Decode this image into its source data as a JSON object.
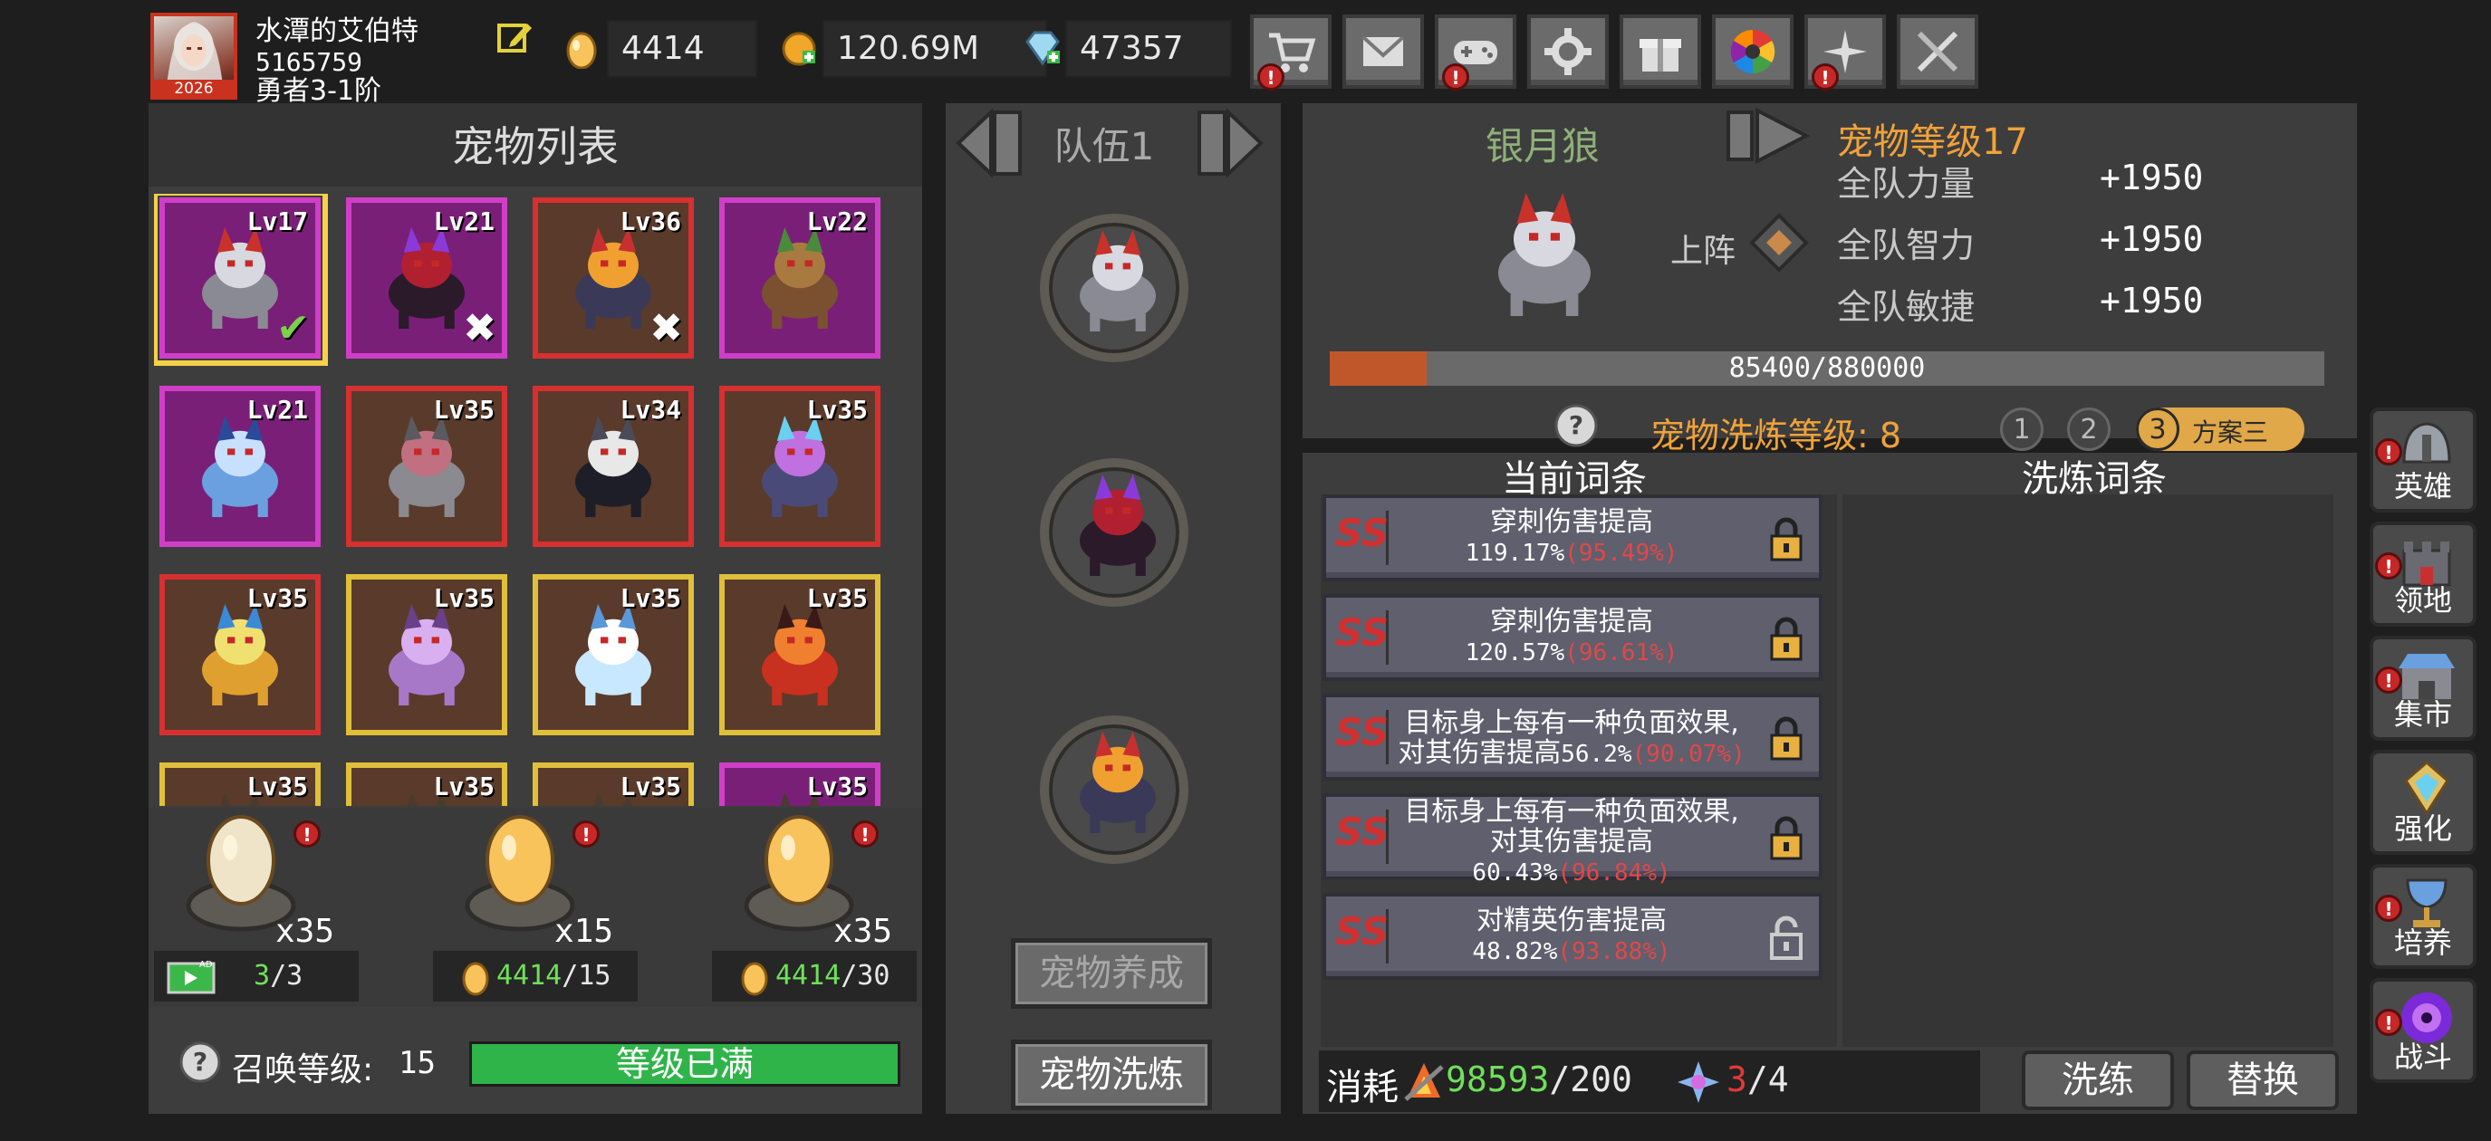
{
  "player": {
    "name": "水潭的艾伯特",
    "id": "5165759",
    "rank": "勇者3-1阶",
    "avatar_year": "2026"
  },
  "resources": [
    {
      "icon": "egg-icon",
      "value": "4414"
    },
    {
      "icon": "gold-coin-icon",
      "value": "120.69M"
    },
    {
      "icon": "diamond-icon",
      "value": "47357"
    }
  ],
  "top_buttons": [
    {
      "name": "shop",
      "icon": "cart-icon",
      "alert": true
    },
    {
      "name": "mail",
      "icon": "mail-icon",
      "alert": false
    },
    {
      "name": "gamepad",
      "icon": "gamepad-icon",
      "alert": true
    },
    {
      "name": "settings",
      "icon": "gear-icon",
      "alert": false
    },
    {
      "name": "gift",
      "icon": "gift-icon",
      "alert": false
    },
    {
      "name": "color-wheel",
      "icon": "color-wheel-icon",
      "alert": false
    },
    {
      "name": "event",
      "icon": "sparkle-icon",
      "alert": true
    },
    {
      "name": "battle",
      "icon": "crossed-swords-icon",
      "alert": false
    }
  ],
  "pet_list": {
    "title": "宠物列表",
    "pets": [
      {
        "level": "Lv17",
        "rarity": "purple",
        "mark": "check",
        "creature": "silver-wolf"
      },
      {
        "level": "Lv21",
        "rarity": "purple",
        "mark": "x",
        "creature": "witch-hat-imp"
      },
      {
        "level": "Lv36",
        "rarity": "red",
        "mark": "x",
        "creature": "bat-demon"
      },
      {
        "level": "Lv22",
        "rarity": "purple",
        "mark": "",
        "creature": "treant"
      },
      {
        "level": "Lv21",
        "rarity": "purple",
        "mark": "",
        "creature": "ice-ghost"
      },
      {
        "level": "Lv35",
        "rarity": "red",
        "mark": "",
        "creature": "gray-bat"
      },
      {
        "level": "Lv34",
        "rarity": "red",
        "mark": "",
        "creature": "reaper"
      },
      {
        "level": "Lv35",
        "rarity": "red",
        "mark": "",
        "creature": "unicorn"
      },
      {
        "level": "Lv35",
        "rarity": "red",
        "mark": "",
        "creature": "flame-skull"
      },
      {
        "level": "Lv35",
        "rarity": "gold",
        "mark": "",
        "creature": "scorpion"
      },
      {
        "level": "Lv35",
        "rarity": "gold",
        "mark": "",
        "creature": "ice-beast"
      },
      {
        "level": "Lv35",
        "rarity": "gold",
        "mark": "",
        "creature": "lava-beast"
      },
      {
        "level": "Lv35",
        "rarity": "gold",
        "mark": "",
        "creature": ""
      },
      {
        "level": "Lv35",
        "rarity": "gold",
        "mark": "",
        "creature": ""
      },
      {
        "level": "Lv35",
        "rarity": "gold",
        "mark": "",
        "creature": ""
      },
      {
        "level": "Lv35",
        "rarity": "purple",
        "mark": "",
        "creature": ""
      }
    ]
  },
  "eggs": [
    {
      "count": "x35",
      "cost_icon": "ad-icon",
      "cost_have": "3",
      "cost_need": "/3",
      "tint": "#f0e4c8"
    },
    {
      "count": "x15",
      "cost_icon": "egg-icon",
      "cost_have": "4414",
      "cost_need": "/15",
      "tint": "#f7c35a"
    },
    {
      "count": "x35",
      "cost_icon": "egg-icon",
      "cost_have": "4414",
      "cost_need": "/30",
      "tint": "#f7c35a"
    }
  ],
  "summon": {
    "label": "召唤等级:",
    "level": "15",
    "status": "等级已满"
  },
  "team": {
    "title": "队伍1",
    "slots": [
      "silver-wolf",
      "witch-hat-imp",
      "bat-demon"
    ],
    "btn_raise": "宠物养成",
    "btn_refine": "宠物洗炼"
  },
  "pet_detail": {
    "name": "银月狼",
    "deploy_label": "上阵",
    "level_label": "宠物等级17",
    "stats": [
      {
        "label": "全队力量",
        "value": "+1950"
      },
      {
        "label": "全队智力",
        "value": "+1950"
      },
      {
        "label": "全队敏捷",
        "value": "+1950"
      }
    ],
    "exp_text": "85400/880000",
    "exp_fraction": 0.097
  },
  "refine": {
    "level_label": "宠物洗炼等级: 8",
    "plans": [
      "1",
      "2",
      "3"
    ],
    "plan_active_label": "方案三",
    "current_header": "当前词条",
    "new_header": "洗炼词条",
    "affixes": [
      {
        "name": "穿刺伤害提高",
        "value": "119.17%",
        "pct": "(95.49%)",
        "locked": true,
        "lines": 1
      },
      {
        "name": "穿刺伤害提高",
        "value": "120.57%",
        "pct": "(96.61%)",
        "locked": true,
        "lines": 1
      },
      {
        "name": "目标身上每有一种负面效果, 对其伤害提高",
        "value": "56.2%",
        "pct": "(90.07%)",
        "locked": true,
        "lines": 2
      },
      {
        "name": "目标身上每有一种负面效果, 对其伤害提高",
        "value": "60.43%",
        "pct": "(96.84%)",
        "locked": true,
        "lines": 3
      },
      {
        "name": "对精英伤害提高",
        "value": "48.82%",
        "pct": "(93.88%)",
        "locked": false,
        "lines": 1
      }
    ],
    "cost_label": "消耗",
    "cost1_have": "98593",
    "cost1_need": "/200",
    "cost2_have": "3",
    "cost2_need": "/4",
    "btn_refine": "洗练",
    "btn_replace": "替换"
  },
  "side_menu": [
    {
      "label": "英雄",
      "icon": "helmet-icon",
      "alert": true
    },
    {
      "label": "领地",
      "icon": "castle-icon",
      "alert": true
    },
    {
      "label": "集市",
      "icon": "market-icon",
      "alert": true
    },
    {
      "label": "强化",
      "icon": "crystal-icon",
      "alert": false
    },
    {
      "label": "培养",
      "icon": "chalice-icon",
      "alert": true
    },
    {
      "label": "战斗",
      "icon": "portal-icon",
      "alert": true
    }
  ],
  "colors": {
    "accent_orange": "#f0a23a",
    "exp_bar": "#c0572a",
    "ok_green": "#2fb44a",
    "alert_red": "#c62828"
  }
}
